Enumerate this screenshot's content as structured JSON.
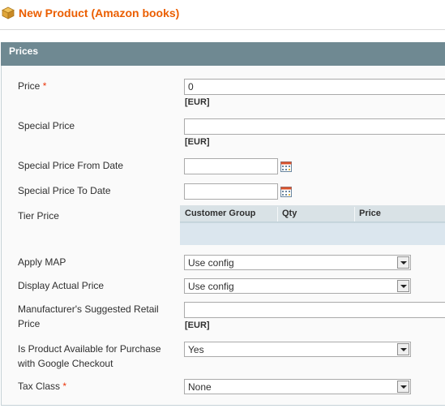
{
  "header": {
    "title": "New Product (Amazon books)",
    "icon": "box-icon"
  },
  "section": {
    "title": "Prices"
  },
  "fields": {
    "price": {
      "label": "Price",
      "required_mark": "*",
      "value": "0",
      "unit": "[EUR]"
    },
    "special_price": {
      "label": "Special Price",
      "value": "",
      "unit": "[EUR]"
    },
    "special_from": {
      "label": "Special Price From Date",
      "value": ""
    },
    "special_to": {
      "label": "Special Price To Date",
      "value": ""
    },
    "tier_price": {
      "label": "Tier Price",
      "columns": [
        "Customer Group",
        "Qty",
        "Price"
      ]
    },
    "apply_map": {
      "label": "Apply MAP",
      "selected": "Use config"
    },
    "display_actual_price": {
      "label": "Display Actual Price",
      "selected": "Use config"
    },
    "msrp": {
      "label_line1": "Manufacturer's Suggested Retail",
      "label_line2": "Price",
      "value": "",
      "unit": "[EUR]"
    },
    "google_checkout": {
      "label_line1": "Is Product Available for Purchase",
      "label_line2": "with Google Checkout",
      "selected": "Yes"
    },
    "tax_class": {
      "label": "Tax Class",
      "required_mark": "*",
      "selected": "None"
    }
  },
  "colors": {
    "title": "#eb5e00",
    "section_header": "#6f8992",
    "required": "#eb340a",
    "tier_header": "#d9e2e6",
    "tier_body": "#dbe6ee"
  }
}
